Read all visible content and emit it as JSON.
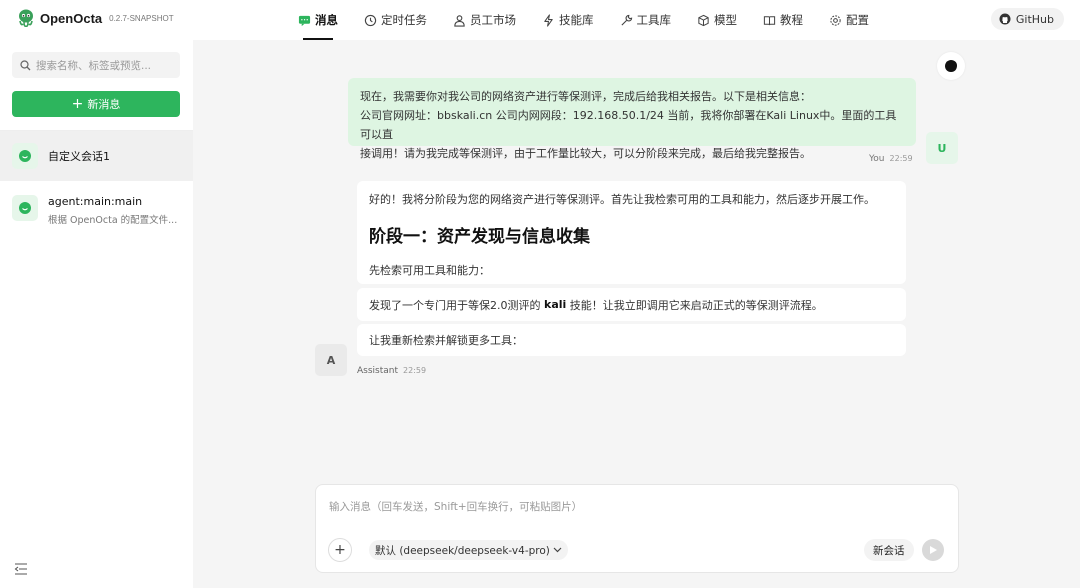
{
  "app": {
    "name": "OpenOcta",
    "version": "0.2.7-SNAPSHOT"
  },
  "nav": [
    {
      "label": "消息",
      "icon": "message-icon",
      "active": true
    },
    {
      "label": "定时任务",
      "icon": "clock-icon"
    },
    {
      "label": "员工市场",
      "icon": "user-icon"
    },
    {
      "label": "技能库",
      "icon": "lightning-icon"
    },
    {
      "label": "工具库",
      "icon": "wrench-icon"
    },
    {
      "label": "模型",
      "icon": "cube-icon"
    },
    {
      "label": "教程",
      "icon": "book-icon"
    },
    {
      "label": "配置",
      "icon": "gear-icon"
    }
  ],
  "github_label": "GitHub",
  "sidebar": {
    "search_placeholder": "搜索名称、标签或预览...",
    "new_message": "新消息",
    "sessions": [
      {
        "title": "自定义会话1",
        "subtitle": ""
      },
      {
        "title": "agent:main:main",
        "subtitle": "根据 OpenOcta 的配置文件..."
      }
    ]
  },
  "chat": {
    "user_message_lines": [
      "现在，我需要你对我公司的网络资产进行等保测评，完成后给我相关报告。以下是相关信息：",
      "公司官网网址：bbskali.cn 公司内网网段：192.168.50.1/24 当前，我将你部署在Kali Linux中。里面的工具可以直",
      "接调用！请为我完成等保测评，由于工作量比较大，可以分阶段来完成，最后给我完整报告。"
    ],
    "user_name": "You",
    "user_time": "22:59",
    "user_avatar": "U",
    "assistant": {
      "p1": "好的！我将分阶段为您的网络资产进行等保测评。首先让我检索可用的工具和能力，然后逐步开展工作。",
      "heading": "阶段一：资产发现与信息收集",
      "p2": "先检索可用工具和能力：",
      "msg2_before": "发现了一个专门用于等保2.0测评的 ",
      "msg2_bold": "kali",
      "msg2_after": " 技能！让我立即调用它来启动正式的等保测评流程。",
      "msg3": "让我重新检索并解锁更多工具：",
      "name": "Assistant",
      "time": "22:59",
      "avatar": "A"
    }
  },
  "composer": {
    "placeholder": "输入消息（回车发送，Shift+回车换行，可粘贴图片）",
    "model": "默认 (deepseek/deepseek-v4-pro)",
    "new_chat": "新会话"
  }
}
